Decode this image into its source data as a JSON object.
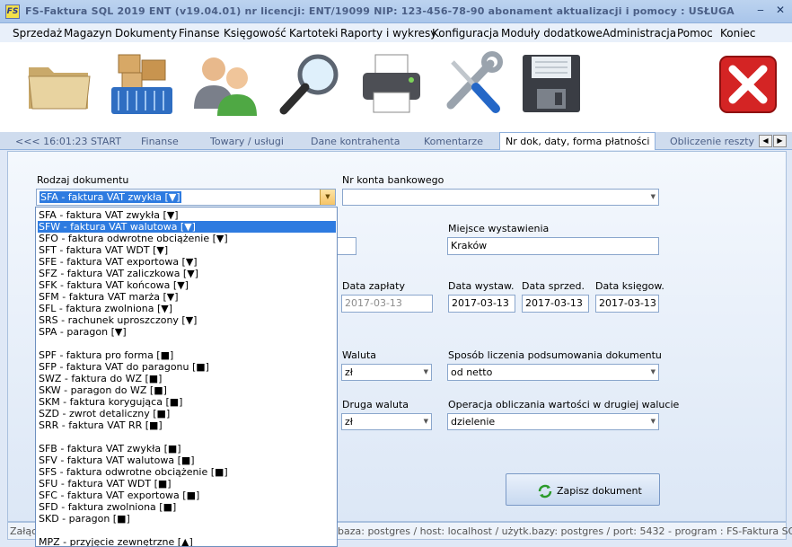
{
  "titlebar": {
    "title": "FS-Faktura SQL 2019 ENT (v19.04.01)     nr licencji: ENT/19099     NIP: 123-456-78-90     abonament aktualizacji i pomocy : USŁUGA A...",
    "logo_text": "FS",
    "minimize": "‒",
    "close": "✕"
  },
  "menu": [
    "Sprzedaż",
    "Magazyn",
    "Dokumenty",
    "Finanse",
    "Księgowość",
    "Kartoteki",
    "Raporty i wykresy",
    "Konfiguracja",
    "Moduły dodatkowe",
    "Administracja",
    "Pomoc",
    "Koniec"
  ],
  "toolbar_icons": [
    "folder-icon",
    "warehouse-boxes-icon",
    "contractors-people-icon",
    "magnifier-icon",
    "printer-icon",
    "tools-icon",
    "floppy-disk-icon",
    "close-red-x-icon"
  ],
  "tabs": {
    "prefix": "<<<  16:01:23  START",
    "items": [
      "Finanse",
      "Towary  / usługi",
      "Dane kontrahenta",
      "Komentarze",
      "Nr dok, daty, forma płatności",
      "Obliczenie reszty"
    ],
    "active_index": 4
  },
  "form": {
    "doc_type_label": "Rodzaj dokumentu",
    "doc_type_value": "SFA - faktura VAT zwykła [▼]",
    "bank_account_label": "Nr konta bankowego",
    "bank_account_value": "",
    "place_label": "Miejsce wystawienia",
    "place_value": "Kraków",
    "left_partial_value": "",
    "payment_date_label": "Data zapłaty",
    "payment_date_value": "2017-03-13",
    "issue_date_label": "Data wystaw.",
    "issue_date_value": "2017-03-13",
    "sale_date_label": "Data sprzed.",
    "sale_date_value": "2017-03-13",
    "book_date_label": "Data księgow.",
    "book_date_value": "2017-03-13",
    "currency_label": "Waluta",
    "currency_value": "zł",
    "summary_method_label": "Sposób liczenia podsumowania dokumentu",
    "summary_method_value": "od netto",
    "second_currency_label": "Druga waluta",
    "second_currency_value": "zł",
    "second_currency_op_label": "Operacja obliczania wartości w drugiej walucie",
    "second_currency_op_value": "dzielenie",
    "save_label": "Zapisz dokument"
  },
  "dropdown": {
    "highlighted_index": 1,
    "items": [
      "SFA - faktura VAT zwykła [▼]",
      "SFW - faktura VAT walutowa [▼]",
      "SFO - faktura odwrotne obciążenie [▼]",
      "SFT - faktura VAT WDT [▼]",
      "SFE - faktura VAT exportowa [▼]",
      "SFZ - faktura VAT zaliczkowa [▼]",
      "SFK - faktura VAT końcowa [▼]",
      "SFM - faktura VAT marża [▼]",
      "SFL - faktura zwolniona [▼]",
      "SRS - rachunek uproszczony [▼]",
      "SPA - paragon [▼]",
      "",
      "SPF - faktura pro forma [■]",
      "SFP - faktura VAT do paragonu [■]",
      "SWZ - faktura do WZ [■]",
      "SKW - paragon do WZ [■]",
      "SKM - faktura korygująca [■]",
      "SZD - zwrot detaliczny [■]",
      "SRR - faktura VAT RR [■]",
      "",
      "SFB - faktura VAT zwykła [■]",
      "SFV - faktura VAT walutowa [■]",
      "SFS - faktura odwrotne obciążenie [■]",
      "SFU - faktura VAT WDT [■]",
      "SFC - faktura VAT exportowa [■]",
      "SFD - faktura zwolniona [■]",
      "SKD - paragon [■]",
      "",
      "MPZ - przyjęcie zewnętrzne [▲]"
    ]
  },
  "status": {
    "left": "Załącz",
    "right": "baza: postgres / host: localhost / użytk.bazy: postgres /  port: 5432  - program :  FS-Faktura SQL PRO"
  }
}
